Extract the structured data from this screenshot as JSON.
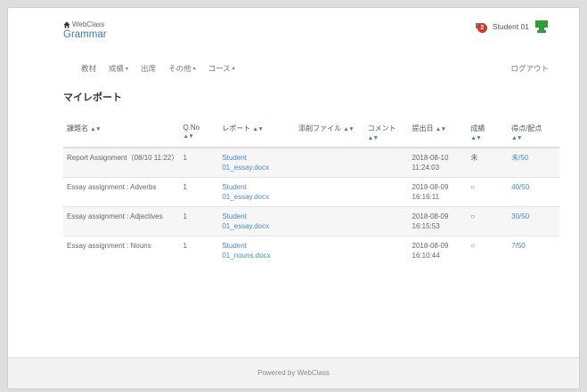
{
  "header": {
    "home_label": "WebClass",
    "course_name": "Grammar",
    "notification_count": "2",
    "user_name": "Student 01"
  },
  "nav": {
    "items": [
      {
        "label": "教材"
      },
      {
        "label": "成績",
        "caret": "▾"
      },
      {
        "label": "出席"
      },
      {
        "label": "その他",
        "caret": "▾"
      },
      {
        "label": "コース",
        "caret": "▾"
      }
    ],
    "logout": "ログアウト"
  },
  "page_title": "マイレポート",
  "table": {
    "sort_glyph": "▲▼",
    "headers": {
      "title": "課題名",
      "qno_line1": "Q.No",
      "report": "レポート",
      "attachment": "添削ファイル",
      "comment": "コメント",
      "date": "提出日",
      "grade": "成績",
      "score": "得点/配点"
    },
    "rows": [
      {
        "title": "Report Assignment（08/10 11:22）",
        "qno": "1",
        "report_line1": "Student",
        "report_line2": "01_essay.docx",
        "date_line1": "2018-08-10",
        "date_line2": "11:24:03",
        "grade": "未",
        "score": "未/50"
      },
      {
        "title": "Essay assignment : Adverbs",
        "qno": "1",
        "report_line1": "Student",
        "report_line2": "01_essay.docx",
        "date_line1": "2018-08-09",
        "date_line2": "16:16:11",
        "grade": "○",
        "score": "40/50"
      },
      {
        "title": "Essay assignment : Adjectives",
        "qno": "1",
        "report_line1": "Student",
        "report_line2": "01_essay.docx",
        "date_line1": "2018-08-09",
        "date_line2": "16:15:53",
        "grade": "○",
        "score": "30/50"
      },
      {
        "title": "Essay assignment : Nouns",
        "qno": "1",
        "report_line1": "Student",
        "report_line2": "01_nouns.docx",
        "date_line1": "2018-08-09",
        "date_line2": "16:10:44",
        "grade": "○",
        "score": "7/50"
      }
    ]
  },
  "footer": {
    "text": "Powered by WebClass"
  },
  "colors": {
    "link": "#4a88c4",
    "badge": "#d9342b",
    "avatar": "#2e9e3a"
  }
}
